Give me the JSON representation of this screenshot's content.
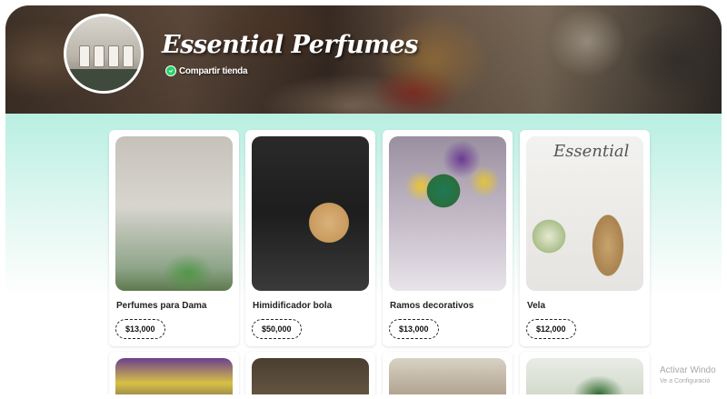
{
  "store": {
    "title": "Essential Perfumes",
    "share_label": "Compartir tienda"
  },
  "products": [
    {
      "name": "Perfumes para Dama",
      "price": "$13,000"
    },
    {
      "name": "Himidificador bola",
      "price": "$50,000"
    },
    {
      "name": "Ramos decorativos",
      "price": "$13,000"
    },
    {
      "name": "Vela",
      "price": "$12,000"
    }
  ],
  "photo_labels": {
    "vela_brand": "Essential"
  },
  "watermark": {
    "line1": "Activar Windo",
    "line2": "Ve a Configuració"
  },
  "colors": {
    "background_top": "#9fe8d6",
    "share_icon": "#25d366",
    "card_bg": "#ffffff"
  },
  "icons": [
    "whatsapp-icon"
  ]
}
